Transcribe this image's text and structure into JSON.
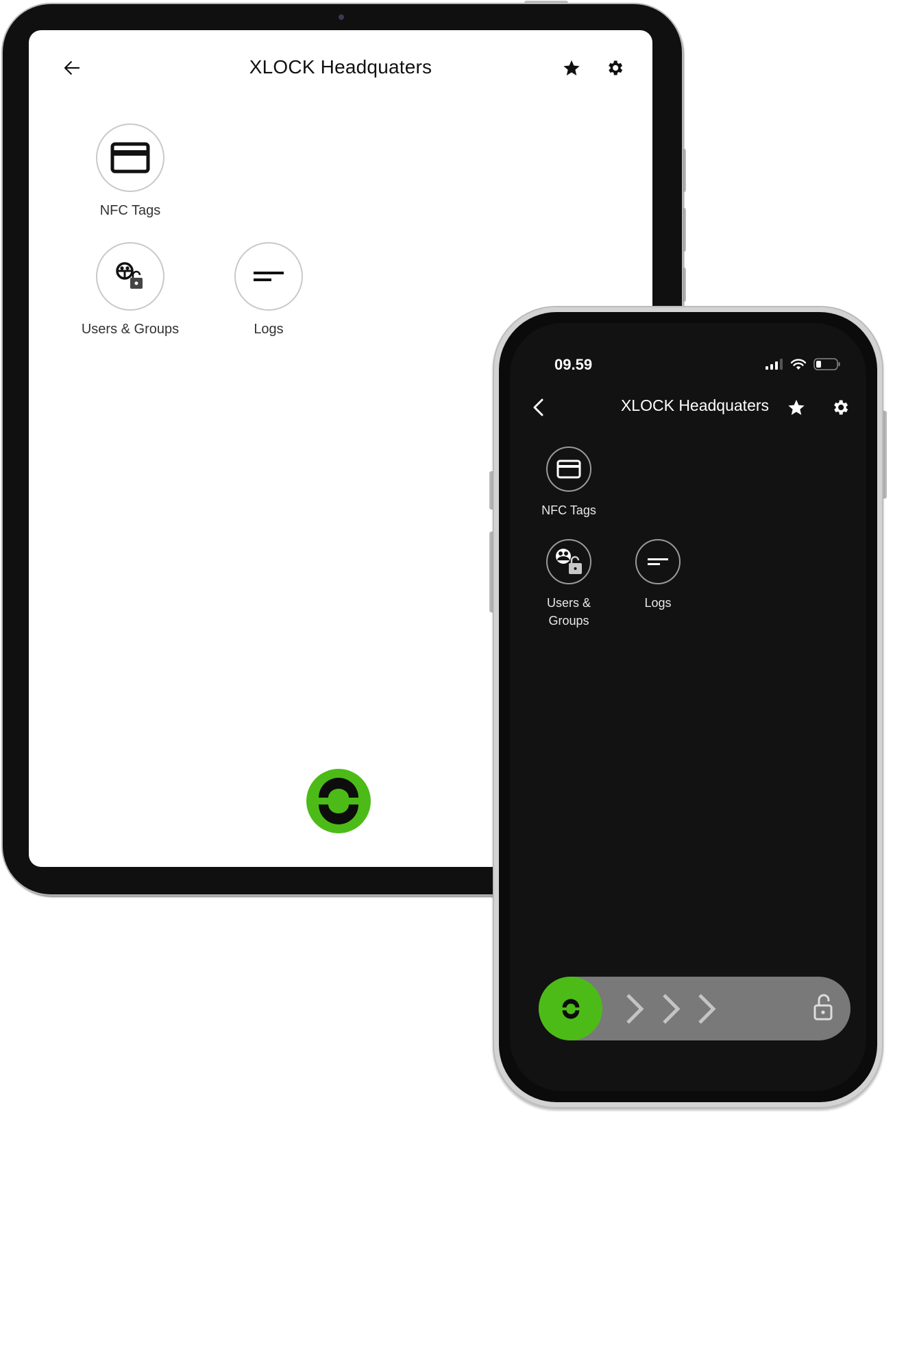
{
  "tablet": {
    "theme": "light",
    "header": {
      "title": "XLOCK Headquaters",
      "back_icon": "arrow-left-icon",
      "favorite_icon": "star-icon",
      "settings_icon": "gear-icon"
    },
    "tiles": [
      {
        "label": "NFC Tags",
        "icon": "credit-card-icon"
      },
      {
        "label": "Users & Groups",
        "icon": "users-lock-icon"
      },
      {
        "label": "Logs",
        "icon": "lines-icon"
      }
    ],
    "logo_button": {
      "icon": "xlock-logo-icon",
      "color": "#4cbb17"
    }
  },
  "phone": {
    "theme": "dark",
    "status_bar": {
      "time": "09.59",
      "signal_icon": "cellular-signal-icon",
      "wifi_icon": "wifi-icon",
      "battery_icon": "battery-low-icon"
    },
    "header": {
      "title": "XLOCK Headquaters",
      "back_icon": "chevron-left-icon",
      "favorite_icon": "star-icon",
      "settings_icon": "gear-icon"
    },
    "tiles": [
      {
        "label": "NFC Tags",
        "icon": "credit-card-icon"
      },
      {
        "label": "Users &",
        "label_line2": "Groups",
        "icon": "users-lock-icon"
      },
      {
        "label": "Logs",
        "icon": "lines-icon"
      }
    ],
    "unlock_slider": {
      "knob_icon": "xlock-logo-icon",
      "arrow_icons": [
        "chevron-right-icon",
        "chevron-right-icon",
        "chevron-right-icon"
      ],
      "end_icon": "unlock-icon",
      "progress": 0,
      "knob_color": "#4cbb17",
      "track_color": "#797979"
    }
  },
  "colors": {
    "accent_green": "#4cbb17",
    "phone_background": "#121212",
    "device_bezel": "#101010"
  }
}
